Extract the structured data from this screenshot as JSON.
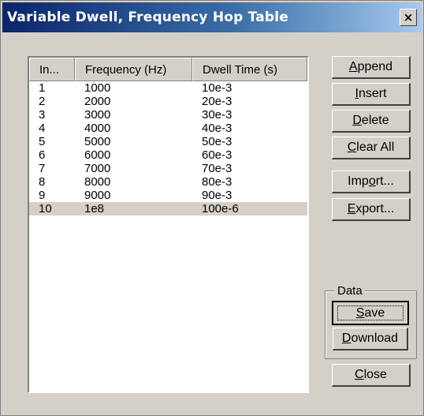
{
  "window": {
    "title": "Variable Dwell, Frequency Hop Table",
    "close_glyph": "×"
  },
  "table": {
    "columns": [
      "In...",
      "Frequency (Hz)",
      "Dwell Time (s)"
    ],
    "rows": [
      {
        "index": "1",
        "frequency": "1000",
        "dwell": "10e-3"
      },
      {
        "index": "2",
        "frequency": "2000",
        "dwell": "20e-3"
      },
      {
        "index": "3",
        "frequency": "3000",
        "dwell": "30e-3"
      },
      {
        "index": "4",
        "frequency": "4000",
        "dwell": "40e-3"
      },
      {
        "index": "5",
        "frequency": "5000",
        "dwell": "50e-3"
      },
      {
        "index": "6",
        "frequency": "6000",
        "dwell": "60e-3"
      },
      {
        "index": "7",
        "frequency": "7000",
        "dwell": "70e-3"
      },
      {
        "index": "8",
        "frequency": "8000",
        "dwell": "80e-3"
      },
      {
        "index": "9",
        "frequency": "9000",
        "dwell": "90e-3"
      },
      {
        "index": "10",
        "frequency": "1e8",
        "dwell": "100e-6"
      }
    ],
    "selected_row": "10"
  },
  "buttons": {
    "append": {
      "mnemonic": "A",
      "rest": "ppend"
    },
    "insert": {
      "mnemonic": "I",
      "rest": "nsert"
    },
    "delete": {
      "mnemonic": "D",
      "rest": "elete"
    },
    "clear_all": {
      "mnemonic": "C",
      "rest": "lear All"
    },
    "import": {
      "pre": "Imp",
      "mnemonic": "o",
      "rest": "rt..."
    },
    "export": {
      "mnemonic": "E",
      "rest": "xport..."
    },
    "save": {
      "mnemonic": "S",
      "rest": "ave"
    },
    "download": {
      "mnemonic": "D",
      "rest": "ownload"
    },
    "close": {
      "mnemonic": "C",
      "rest": "lose"
    }
  },
  "data_group": {
    "label": "Data"
  }
}
